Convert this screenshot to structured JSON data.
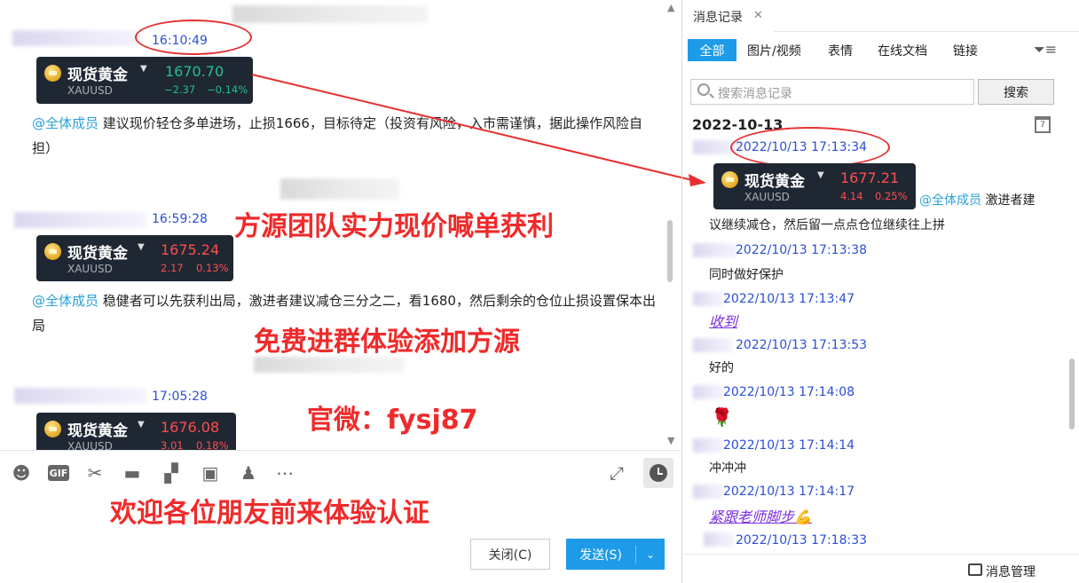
{
  "chat": {
    "messages": [
      {
        "time": "16:10:49",
        "card": {
          "name": "现货黄金",
          "symbol": "XAUUSD",
          "price": "1670.70",
          "change": "−2.37",
          "pct": "−0.14%"
        },
        "mention": "@全体成员",
        "text": "建议现价轻仓多单进场，止损1666，目标待定（投资有风险，入市需谨慎，据此操作风险自担）"
      },
      {
        "time": "16:59:28",
        "card": {
          "name": "现货黄金",
          "symbol": "XAUUSD",
          "price": "1675.24",
          "change": "2.17",
          "pct": "0.13%"
        },
        "mention": "@全体成员",
        "text": "稳健者可以先获利出局，激进者建议减仓三分之二，看1680，然后剩余的仓位止损设置保本出局"
      },
      {
        "time": "17:05:28",
        "card": {
          "name": "现货黄金",
          "symbol": "XAUUSD",
          "price": "1676.08",
          "change": "3.01",
          "pct": "0.18%"
        }
      }
    ],
    "promo": {
      "line1": "方源团队实力现价喊单获利",
      "line2": "免费进群体验添加方源",
      "line3": "官微：fysj87",
      "line4": "欢迎各位朋友前来体验认证"
    }
  },
  "toolbar": {
    "icons": [
      "emoji-icon",
      "gif-icon",
      "scissors-icon",
      "folder-icon",
      "clipboard-icon",
      "image-icon",
      "bell-icon",
      "more-icon"
    ],
    "gif_label": "GIF",
    "close_label": "关闭(C)",
    "send_label": "发送(S)"
  },
  "history": {
    "tab_title": "消息记录",
    "filters": [
      "全部",
      "图片/视频",
      "表情",
      "在线文档",
      "链接"
    ],
    "search_placeholder": "搜索消息记录",
    "search_button": "搜索",
    "date": "2022-10-13",
    "calendar_day": "7",
    "entries": [
      {
        "time": "2022/10/13 17:13:34",
        "card": {
          "name": "现货黄金",
          "symbol": "XAUUSD",
          "price": "1677.21",
          "change": "4.14",
          "pct": "0.25%"
        },
        "mention": "@全体成员",
        "text_a": "激进者建",
        "text_b": "议继续减仓，然后留一点点仓位继续往上拼"
      },
      {
        "time": "2022/10/13 17:13:38",
        "text": "同时做好保护"
      },
      {
        "time": "2022/10/13 17:13:47",
        "text": "收到"
      },
      {
        "time": "2022/10/13 17:13:53",
        "text": "好的"
      },
      {
        "time": "2022/10/13 17:14:08",
        "text": "🌹"
      },
      {
        "time": "2022/10/13 17:14:14",
        "text": "冲冲冲"
      },
      {
        "time": "2022/10/13 17:14:17",
        "text": "紧跟老师脚步💪"
      },
      {
        "time": "2022/10/13 17:18:33",
        "text": ""
      }
    ],
    "manage_label": "消息管理"
  },
  "colors": {
    "accent": "#1e9be8",
    "up": "#ff4d4d",
    "down": "#22c08a",
    "promo": "#f02a2a",
    "time": "#2b4fd6"
  }
}
